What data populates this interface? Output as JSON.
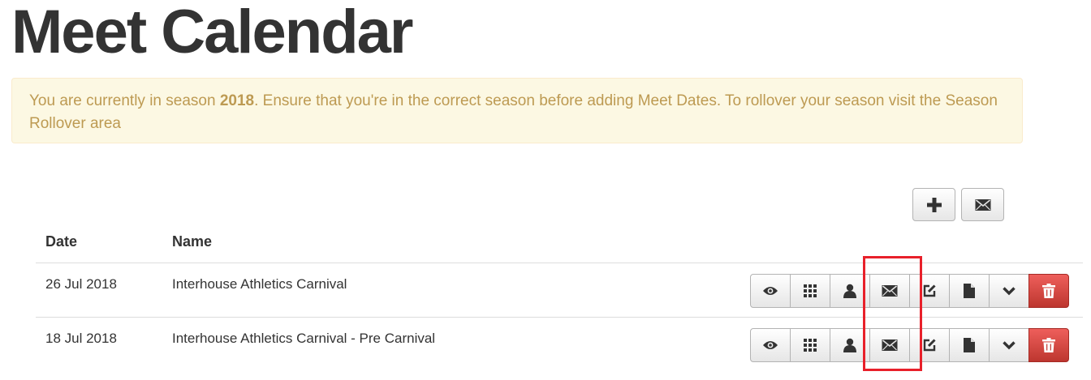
{
  "page": {
    "title": "Meet Calendar"
  },
  "alert": {
    "prefix": "You are currently in season ",
    "season": "2018",
    "suffix": ". Ensure that you're in the correct season before adding Meet Dates. To rollover your season visit the Season Rollover area"
  },
  "toolbar": {
    "add_icon": "plus-icon",
    "email_icon": "envelope-icon"
  },
  "table": {
    "headers": {
      "date": "Date",
      "name": "Name"
    },
    "rows": [
      {
        "date": "26 Jul 2018",
        "name": "Interhouse Athletics Carnival"
      },
      {
        "date": "18 Jul 2018",
        "name": "Interhouse Athletics Carnival - Pre Carnival"
      }
    ],
    "row_actions": [
      "eye-icon",
      "grid-icon",
      "user-icon",
      "envelope-icon",
      "edit-icon",
      "file-icon",
      "chevron-down-icon",
      "trash-icon"
    ]
  },
  "colors": {
    "alert_bg": "#fcf8e3",
    "alert_text": "#bd9a52",
    "danger": "#da4f49",
    "highlight": "#e8202a"
  }
}
